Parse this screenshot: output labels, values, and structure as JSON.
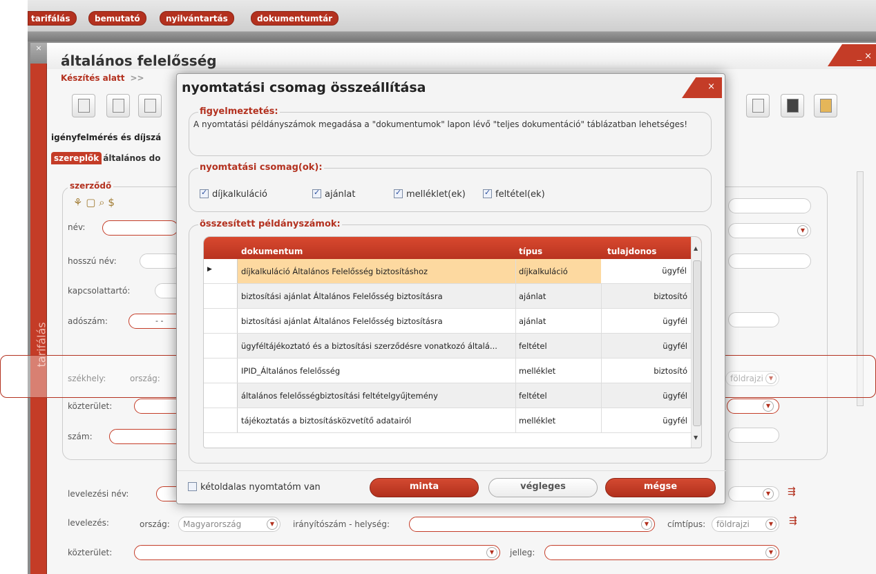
{
  "top_tabs": [
    "tarifálás",
    "bemutató",
    "nyilvántartás",
    "dokumentumtár"
  ],
  "sidebar": {
    "label": "tarifálás",
    "close": "×"
  },
  "panel": {
    "title": "általános felelősség",
    "window_controls": "_ ×",
    "status": "Készítés alatt",
    "status_arrow": ">>",
    "section": "igényfelmérés és díjszá",
    "tabs": {
      "active": "szereplők",
      "rest": "általános  do"
    },
    "contract_legend": "szerződő",
    "labels": {
      "name": "név:",
      "long_name": "hosszú név:",
      "contact": "kapcsolattartó:",
      "tax": "adószám:",
      "tax_value": "- -",
      "seat": "székhely:",
      "country": "ország:",
      "street": "közterület:",
      "number": "szám:",
      "mail_name": "levelezési név:",
      "mail": "levelezés:",
      "mail_country": "ország:",
      "mail_country_value": "Magyarország",
      "zip_city": "irányítószám - helység:",
      "addr_type": "címtípus:",
      "addr_type_value": "földrajzi",
      "street2": "közterület:",
      "character": "jelleg:",
      "seat_addr_type_value": "földrajzi"
    }
  },
  "modal": {
    "title": "nyomtatási csomag összeállítása",
    "close": "×",
    "warning_legend": "figyelmeztetés:",
    "warning_text": "A nyomtatási példányszámok megadása a \"dokumentumok\" lapon lévő \"teljes dokumentáció\" táblázatban lehetséges!",
    "packages_legend": "nyomtatási csomag(ok):",
    "packages": [
      {
        "label": "díjkalkuláció",
        "checked": true
      },
      {
        "label": "ajánlat",
        "checked": true
      },
      {
        "label": "melléklet(ek)",
        "checked": true
      },
      {
        "label": "feltétel(ek)",
        "checked": true
      }
    ],
    "summary_legend": "összesített példányszámok:",
    "columns": [
      "dokumentum",
      "típus",
      "tulajdonos"
    ],
    "rows": [
      {
        "doc": "díjkalkuláció Általános Felelősség biztosításhoz",
        "type": "díjkalkuláció",
        "owner": "ügyfél",
        "selected": true
      },
      {
        "doc": "biztosítási ajánlat Általános Felelősség biztosításra",
        "type": "ajánlat",
        "owner": "biztosító"
      },
      {
        "doc": "biztosítási ajánlat Általános Felelősség biztosításra",
        "type": "ajánlat",
        "owner": "ügyfél"
      },
      {
        "doc": "ügyféltájékoztató és a biztosítási szerződésre vonatkozó általá...",
        "type": "feltétel",
        "owner": "ügyfél"
      },
      {
        "doc": "IPID_Általános felelősség",
        "type": "melléklet",
        "owner": "biztosító"
      },
      {
        "doc": "általános felelősségbiztosítási feltételgyűjtemény",
        "type": "feltétel",
        "owner": "ügyfél"
      },
      {
        "doc": "tájékoztatás a biztosításközvetítő adatairól",
        "type": "melléklet",
        "owner": "ügyfél"
      }
    ],
    "duplex_label": "kétoldalas nyomtatóm van",
    "duplex_checked": false,
    "buttons": {
      "sample": "minta",
      "final": "végleges",
      "cancel": "mégse"
    }
  },
  "colors": {
    "accent": "#c43c27",
    "selected_row": "#fdd9a0",
    "alt_row": "#efefef"
  }
}
